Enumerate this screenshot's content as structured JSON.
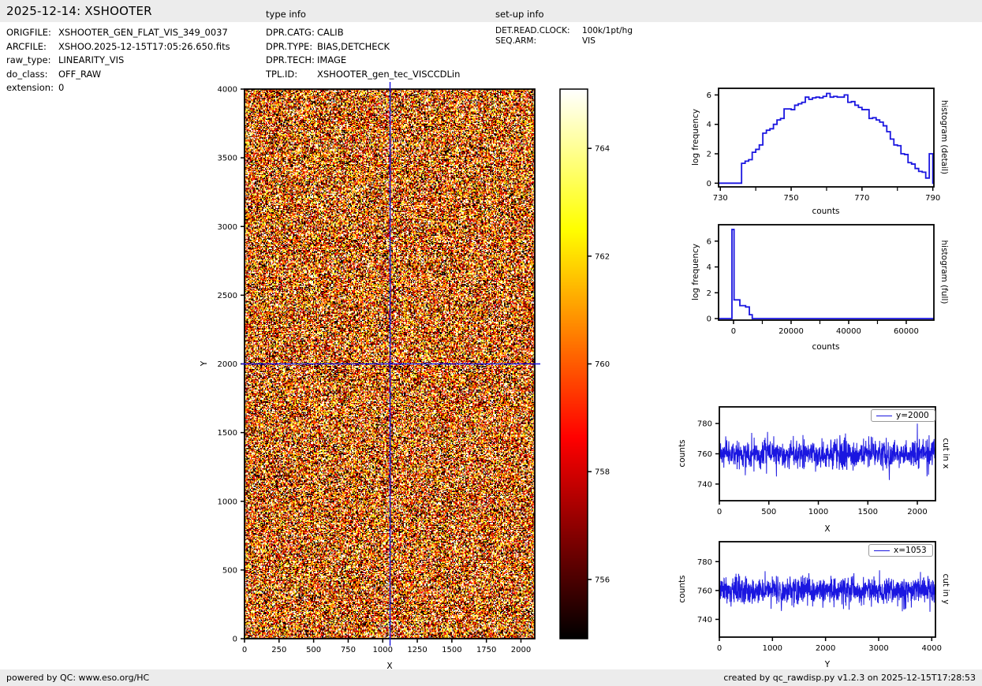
{
  "page": {
    "background": "#ffffff",
    "bar_color": "#ececec",
    "accent_blue": "#1a16e0"
  },
  "header": {
    "title": "2025-12-14: XSHOOTER",
    "type_info_label": "type info",
    "setup_info_label": "set-up info"
  },
  "file_info": {
    "rows": [
      {
        "label": "ORIGFILE:",
        "value": "XSHOOTER_GEN_FLAT_VIS_349_0037"
      },
      {
        "label": "ARCFILE:",
        "value": "XSHOO.2025-12-15T17:05:26.650.fits"
      },
      {
        "label": "raw_type:",
        "value": "LINEARITY_VIS"
      },
      {
        "label": "do_class:",
        "value": "OFF_RAW"
      },
      {
        "label": "extension:",
        "value": "0"
      }
    ]
  },
  "type_info": {
    "rows": [
      {
        "label": "DPR.CATG:",
        "value": "CALIB"
      },
      {
        "label": "DPR.TYPE:",
        "value": "BIAS,DETCHECK"
      },
      {
        "label": "DPR.TECH:",
        "value": "IMAGE"
      },
      {
        "label": "TPL.ID:",
        "value": "XSHOOTER_gen_tec_VISCCDLin"
      }
    ]
  },
  "setup_info": {
    "rows": [
      {
        "label": "DET.READ.CLOCK:",
        "value": "100k/1pt/hg"
      },
      {
        "label": "SEQ.ARM:",
        "value": "VIS"
      }
    ]
  },
  "footer": {
    "left": "powered by QC: www.eso.org/HC",
    "right": "created by qc_rawdisp.py v1.2.3 on 2025-12-15T17:28:53"
  },
  "chart_data": [
    {
      "id": "main",
      "type": "heatmap",
      "description": "raw detector frame, uniform bias noise, hot colormap",
      "xlabel": "X",
      "ylabel": "Y",
      "xlim": [
        0,
        2100
      ],
      "ylim": [
        0,
        4000
      ],
      "x_ticks": [
        0,
        250,
        500,
        750,
        1000,
        1250,
        1500,
        1750,
        2000
      ],
      "y_ticks": [
        0,
        500,
        1000,
        1500,
        2000,
        2500,
        3000,
        3500,
        4000
      ],
      "crosshair": {
        "x": 1053,
        "y": 2000
      },
      "colormap": "hot",
      "vmin": 754.9,
      "vmax": 765.1,
      "distribution": {
        "mean": 760,
        "std": 4.5
      },
      "seed": 42
    },
    {
      "id": "cbar",
      "type": "colorbar",
      "colormap": "hot",
      "vmin": 754.9,
      "vmax": 765.1,
      "ticks": [
        756,
        758,
        760,
        762,
        764
      ]
    },
    {
      "id": "h1",
      "type": "step-histogram",
      "right_label": "histogram (detail)",
      "xlabel": "counts",
      "ylabel": "log frequency",
      "xlim": [
        729.5,
        790.3
      ],
      "ylim": [
        -0.25,
        6.45
      ],
      "x_ticks": [
        730,
        750,
        770,
        790
      ],
      "x_minor_ticks": [
        740,
        760,
        780
      ],
      "y_ticks": [
        0,
        2,
        4,
        6
      ],
      "bin_start": 736,
      "bin_width": 1,
      "values": [
        1.35,
        1.5,
        1.6,
        2.1,
        2.3,
        2.6,
        3.4,
        3.6,
        3.7,
        4.0,
        4.3,
        4.4,
        5.05,
        5.05,
        5.0,
        5.3,
        5.4,
        5.5,
        5.85,
        5.7,
        5.8,
        5.85,
        5.8,
        5.9,
        6.1,
        5.85,
        5.9,
        5.85,
        5.85,
        6.0,
        5.5,
        5.55,
        5.3,
        5.15,
        5.0,
        5.0,
        4.4,
        4.45,
        4.3,
        4.15,
        3.9,
        3.5,
        3.0,
        2.6,
        2.55,
        2.0,
        1.95,
        1.4,
        1.3,
        1.0,
        0.8,
        0.75,
        0.35,
        2.0
      ]
    },
    {
      "id": "h2",
      "type": "step-histogram",
      "right_label": "histogram (full)",
      "xlabel": "counts",
      "ylabel": "log frequency",
      "xlim": [
        -5200,
        69600
      ],
      "ylim": [
        -0.12,
        7.27
      ],
      "x_ticks": [
        0,
        20000,
        40000,
        60000
      ],
      "x_minor_ticks": [
        10000,
        30000,
        50000
      ],
      "y_ticks": [
        0,
        2,
        4,
        6
      ],
      "edges": [
        -550,
        180,
        2200,
        4200,
        5500,
        6500
      ],
      "values": [
        6.9,
        1.45,
        1.0,
        0.9,
        0.3
      ]
    },
    {
      "id": "c1",
      "type": "line-noise",
      "right_label": "cut in x",
      "legend_label": "y=2000",
      "xlabel": "X",
      "ylabel": "counts",
      "xlim": [
        0,
        2183
      ],
      "ylim": [
        729,
        791
      ],
      "x_ticks": [
        0,
        500,
        1000,
        1500,
        2000
      ],
      "y_ticks": [
        740,
        760,
        780
      ],
      "n": 1050,
      "mean": 760,
      "std": 4.5,
      "seed": 7
    },
    {
      "id": "c2",
      "type": "line-noise",
      "right_label": "cut in y",
      "legend_label": "x=1053",
      "xlabel": "Y",
      "ylabel": "counts",
      "xlim": [
        0,
        4070
      ],
      "ylim": [
        727.7,
        793.8
      ],
      "x_ticks": [
        0,
        1000,
        2000,
        3000,
        4000
      ],
      "y_ticks": [
        740,
        760,
        780
      ],
      "n": 1300,
      "mean": 760,
      "std": 4.5,
      "seed": 13
    }
  ]
}
